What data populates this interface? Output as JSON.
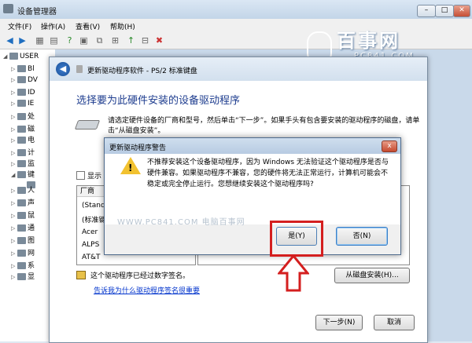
{
  "main_window": {
    "title": "设备管理器",
    "menu": [
      "文件(F)",
      "操作(A)",
      "查看(V)",
      "帮助(H)"
    ],
    "tree": [
      {
        "exp": "◢",
        "label": "USER"
      },
      {
        "exp": "▷",
        "label": "Bl"
      },
      {
        "exp": "▷",
        "label": "DV"
      },
      {
        "exp": "▷",
        "label": "ID"
      },
      {
        "exp": "▷",
        "label": "IE"
      },
      {
        "exp": "▷",
        "label": "处"
      },
      {
        "exp": "▷",
        "label": "磁"
      },
      {
        "exp": "▷",
        "label": "电"
      },
      {
        "exp": "▷",
        "label": "计"
      },
      {
        "exp": "▷",
        "label": "监"
      },
      {
        "exp": "◢",
        "label": "键"
      },
      {
        "exp": "",
        "label": ""
      },
      {
        "exp": "▷",
        "label": "人"
      },
      {
        "exp": "▷",
        "label": "声"
      },
      {
        "exp": "▷",
        "label": "鼠"
      },
      {
        "exp": "▷",
        "label": "通"
      },
      {
        "exp": "▷",
        "label": "图"
      },
      {
        "exp": "▷",
        "label": "网"
      },
      {
        "exp": "▷",
        "label": "系"
      },
      {
        "exp": "▷",
        "label": "显"
      }
    ]
  },
  "watermark": {
    "brand": "百事网",
    "site": "PC841.COM"
  },
  "update_dialog": {
    "title": "更新驱动程序软件 - PS/2 标准键盘",
    "heading": "选择要为此硬件安装的设备驱动程序",
    "description": "请选定硬件设备的厂商和型号，然后单击“下一步”。如果手头有包含要安装的驱动程序的磁盘，请单击“从磁盘安装”。",
    "show_compatible": "显示",
    "manufacturer_header": "厂商",
    "manufacturers": [
      "(Stand",
      "(标准键",
      "Acer",
      "ALPS",
      "AT&T"
    ],
    "signed_text": "这个驱动程序已经过数字签名。",
    "why_link": "告诉我为什么驱动程序签名很重要",
    "have_disk_button": "从磁盘安装(H)...",
    "next_button": "下一步(N)",
    "cancel_button": "取消"
  },
  "warning_dialog": {
    "title": "更新驱动程序警告",
    "close": "x",
    "message": "不推荐安装这个设备驱动程序，因为 Windows 无法验证这个驱动程序是否与硬件兼容。如果驱动程序不兼容，您的硬件将无法正常运行，计算机可能会不稳定或完全停止运行。您想继续安装这个驱动程序吗?",
    "watermark": "WWW.PC841.COM 电脑百事网",
    "yes_button": "是(Y)",
    "no_button": "否(N)"
  },
  "colors": {
    "highlight": "#d41f1f",
    "heading": "#1e3d8f",
    "link": "#0033cc"
  }
}
